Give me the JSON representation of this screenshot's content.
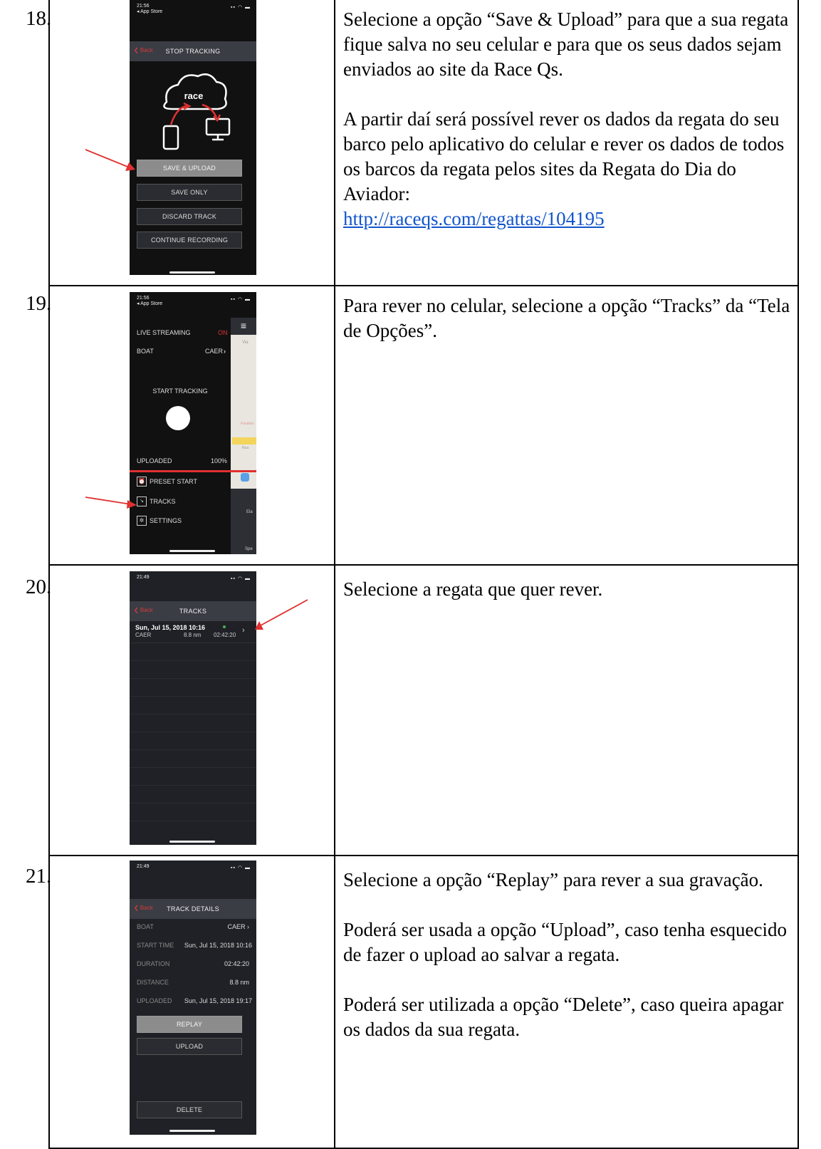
{
  "rows": [
    {
      "number": "18.",
      "paragraphs": [
        "Selecione a opção “Save & Upload” para que a sua regata fique salva no seu celular e para que os seus dados sejam enviados ao site da Race Qs."
      ],
      "paragraph2": "A partir daí será possível rever os dados da regata do seu barco pelo aplicativo do celular e rever os dados de todos os barcos da regata pelos sites da Regata do Dia do Aviador:",
      "link": "http://raceqs.com/regattas/104195",
      "phone": {
        "time": "21:56",
        "carrier": "◂ App Store",
        "back": "❮ Back",
        "title": "STOP TRACKING",
        "cloud_label": "race",
        "buttons": [
          "SAVE & UPLOAD",
          "SAVE ONLY",
          "DISCARD TRACK",
          "CONTINUE RECORDING"
        ]
      }
    },
    {
      "number": "19.",
      "text": "Para rever no celular, selecione a opção “Tracks” da “Tela de Opções”.",
      "phone": {
        "time": "21:56",
        "carrier": "◂ App Store",
        "live_label": "LIVE STREAMING",
        "live_value": "ON",
        "boat_label": "BOAT",
        "boat_value": "CAER",
        "start_label": "START TRACKING",
        "uploaded_label": "UPLOADED",
        "uploaded_value": "100%",
        "menu": [
          "PRESET START",
          "TRACKS",
          "SETTINGS"
        ],
        "map_labels": [
          "Via",
          "Paralelo",
          "Rua",
          "Ela",
          "Spe"
        ]
      }
    },
    {
      "number": "20.",
      "text": "Selecione a regata que quer rever.",
      "phone": {
        "time": "21:49",
        "back": "❮ Back",
        "title": "TRACKS",
        "track_date": "Sun, Jul 15, 2018 10:16",
        "track_boat": "CAER",
        "track_distance": "8.8 nm",
        "track_duration": "02:42:20"
      }
    },
    {
      "number": "21.",
      "p1": "Selecione a opção “Replay” para rever a sua gravação.",
      "p2": "Poderá ser usada a opção “Upload”, caso tenha esquecido de fazer o upload ao salvar a regata.",
      "p3": "Poderá ser utilizada a opção “Delete”, caso queira apagar os dados da sua regata.",
      "phone": {
        "time": "21:49",
        "back": "❮ Back",
        "title": "TRACK DETAILS",
        "details": [
          {
            "label": "BOAT",
            "value": "CAER ›"
          },
          {
            "label": "START TIME",
            "value": "Sun, Jul 15, 2018 10:16"
          },
          {
            "label": "DURATION",
            "value": "02:42:20"
          },
          {
            "label": "DISTANCE",
            "value": "8.8 nm"
          },
          {
            "label": "UPLOADED",
            "value": "Sun, Jul 15, 2018 19:17"
          }
        ],
        "buttons": [
          "REPLAY",
          "UPLOAD",
          "DELETE"
        ]
      }
    }
  ],
  "colors": {
    "accent_red": "#e03030",
    "link": "#1155cc",
    "phone_bg": "#111111"
  }
}
